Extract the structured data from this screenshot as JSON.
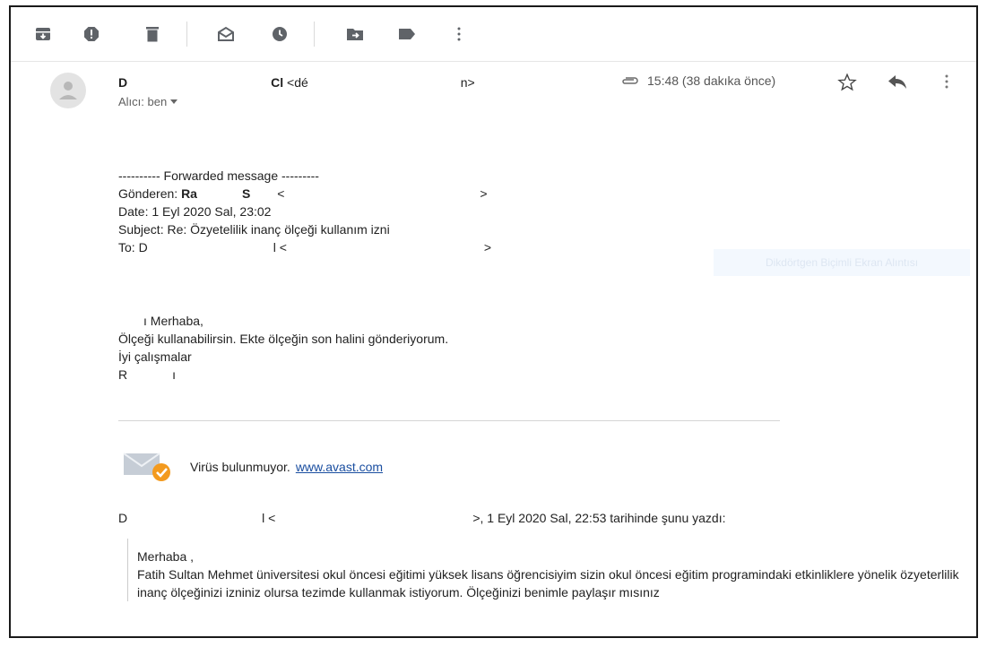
{
  "toolbar": {
    "icons": [
      "archive-icon",
      "report-spam-icon",
      "delete-icon",
      "mark-unread-icon",
      "snooze-icon",
      "move-to-icon",
      "label-icon",
      "more-vert-icon"
    ]
  },
  "header": {
    "sender_initial": "D",
    "sender_tail": "Cl",
    "email_open": "<dé",
    "email_close": "n>",
    "recipient_label": "Alıcı: ben",
    "time": "15:48 (38 dakıka önce)"
  },
  "forward": {
    "banner": "---------- Forwarded message ---------",
    "from_label": "Gönderen:",
    "from_name_a": "Ra",
    "from_name_b": "S",
    "from_email_open": "<",
    "from_email_close": ">",
    "date": "Date: 1 Eyl 2020 Sal, 23:02",
    "subject": "Subject: Re: Özyetelilik inanç ölçeği kullanım izni",
    "to_label": "To: D",
    "to_name_tail": "l",
    "to_email_open": "<",
    "to_email_close": ">"
  },
  "reply": {
    "greeting": "ı Merhaba,",
    "line1": "Ölçeği kullanabilirsin. Ekte ölçeğin son halini gönderiyorum.",
    "line2": "İyi çalışmalar",
    "signature_a": "R",
    "signature_b": "ı"
  },
  "avast": {
    "text": "Virüs bulunmuyor.",
    "link": "www.avast.com"
  },
  "quote_header": {
    "name_initial": "D",
    "name_tail": "l",
    "email_open": "<",
    "email_close": ">,",
    "written": "1 Eyl 2020 Sal, 22:53 tarihinde şunu yazdı:"
  },
  "quote": {
    "greeting": "Merhaba ,",
    "body": "Fatih Sultan Mehmet üniversitesi okul öncesi eğitimi yüksek lisans öğrencisiyim sizin okul öncesi eğitim programindaki etkinliklere yönelik özyeterlilik inanç  ölçeğinizi izniniz olursa tezimde kullanmak istiyorum. Ölçeğinizi benimle paylaşır mısınız"
  },
  "overlay": {
    "ghost_caption": "Dikdörtgen Biçimli Ekran Alıntısı"
  },
  "colors": {
    "icon": "#5f6368",
    "link": "#1a4ea0",
    "avast_badge": "#f39a1e"
  }
}
